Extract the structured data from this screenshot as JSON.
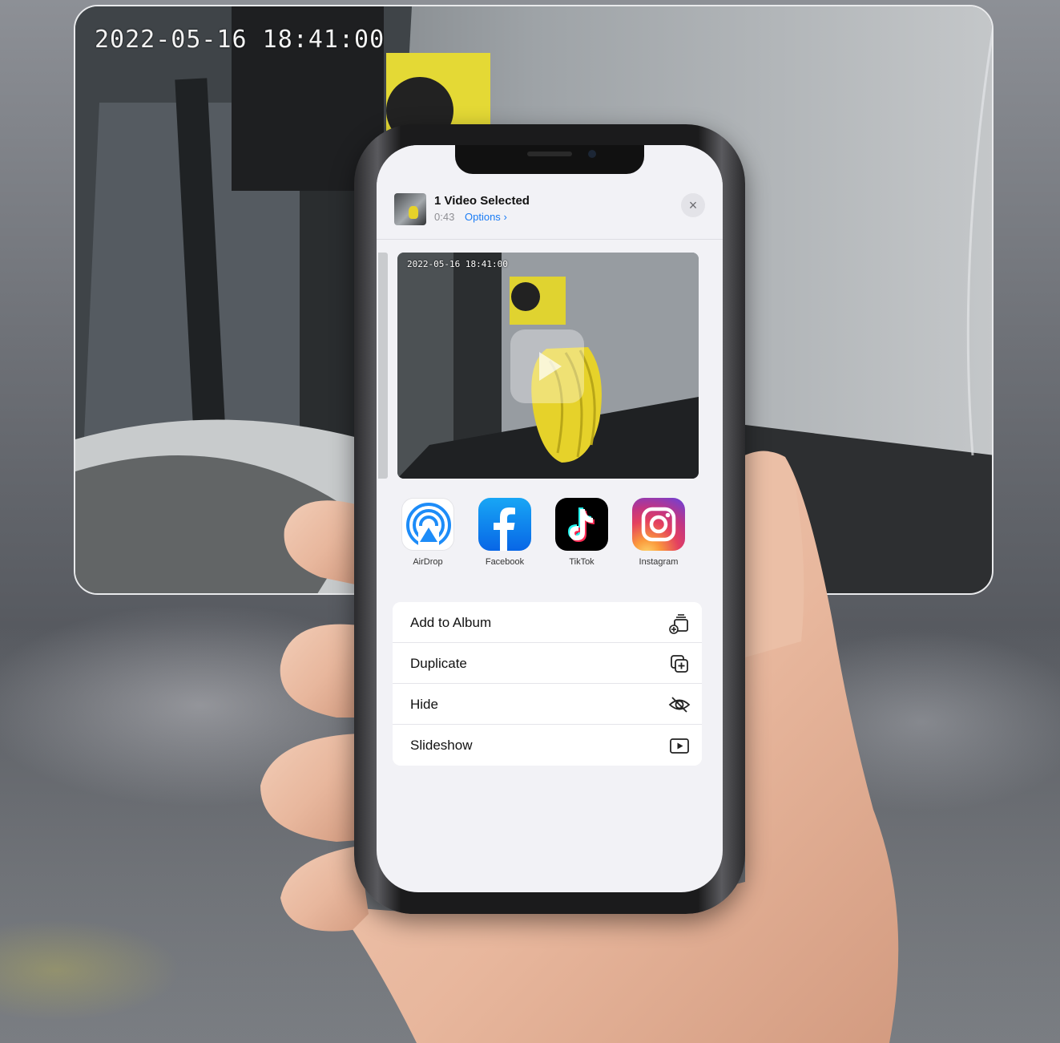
{
  "camera_view": {
    "timestamp": "2022-05-16 18:41:00"
  },
  "share_sheet": {
    "header": {
      "title": "1 Video Selected",
      "duration": "0:43",
      "options_label": "Options",
      "options_chevron": "›",
      "close_glyph": "×"
    },
    "preview": {
      "timestamp": "2022-05-16 18:41:00"
    },
    "apps": [
      {
        "label": "AirDrop",
        "icon": "airdrop-icon"
      },
      {
        "label": "Facebook",
        "icon": "facebook-icon"
      },
      {
        "label": "TikTok",
        "icon": "tiktok-icon"
      },
      {
        "label": "Instagram",
        "icon": "instagram-icon"
      }
    ],
    "actions": [
      {
        "label": "Add to Album",
        "icon": "add-to-album-icon"
      },
      {
        "label": "Duplicate",
        "icon": "duplicate-icon"
      },
      {
        "label": "Hide",
        "icon": "hide-eye-icon"
      },
      {
        "label": "Slideshow",
        "icon": "slideshow-play-icon"
      }
    ]
  },
  "colors": {
    "accent": "#1a7cf5",
    "print_yellow": "#e6d22a",
    "sheet_bg": "#f2f2f6"
  }
}
